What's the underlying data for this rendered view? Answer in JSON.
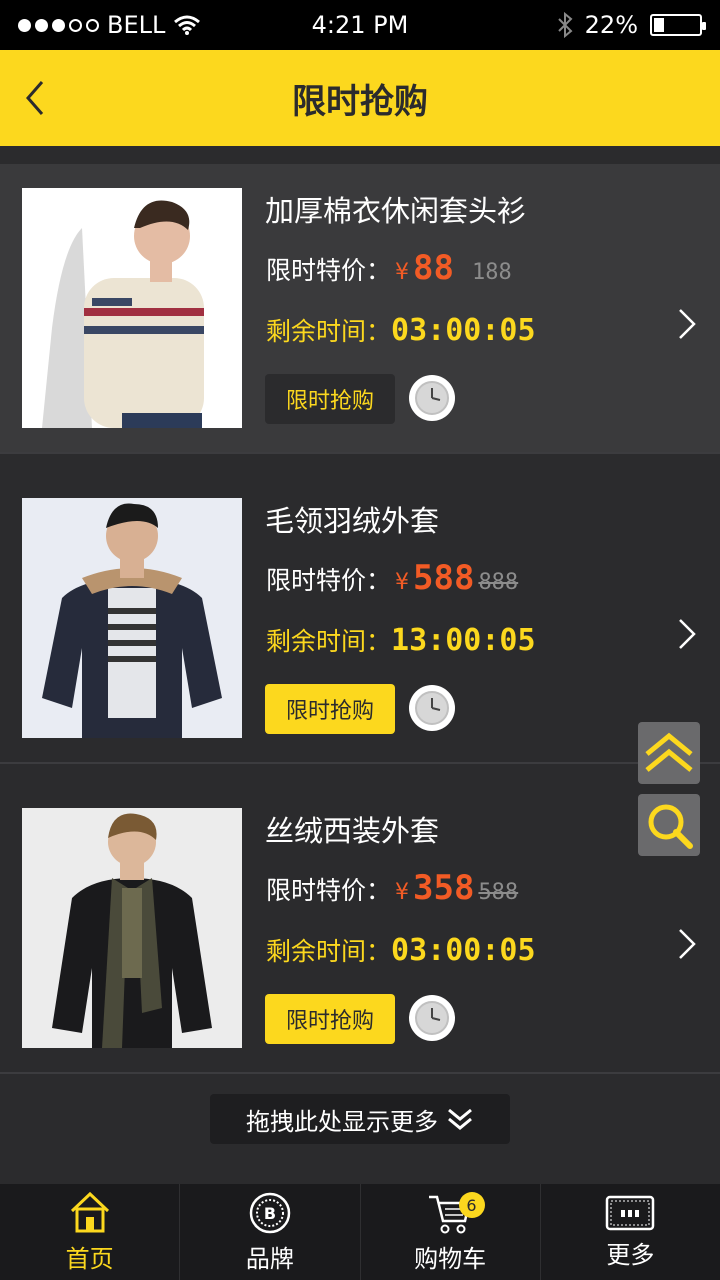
{
  "status": {
    "carrier": "BELL",
    "time": "4:21 PM",
    "battery": "22%",
    "battery_level": 0.22
  },
  "header": {
    "title": "限时抢购"
  },
  "products": [
    {
      "name": "加厚棉衣休闲套头衫",
      "price_label": "限时特价：",
      "currency": "¥",
      "price": "88",
      "old_price": "188",
      "time_label": "剩余时间：",
      "time": "03:00:05",
      "buy_label": "限时抢购"
    },
    {
      "name": "毛领羽绒外套",
      "price_label": "限时特价：",
      "currency": "¥",
      "price": "588",
      "old_price": "888",
      "time_label": "剩余时间：",
      "time": "13:00:05",
      "buy_label": "限时抢购"
    },
    {
      "name": "丝绒西装外套",
      "price_label": "限时特价：",
      "currency": "¥",
      "price": "358",
      "old_price": "588",
      "time_label": "剩余时间：",
      "time": "03:00:05",
      "buy_label": "限时抢购"
    }
  ],
  "load_more": {
    "label": "拖拽此处显示更多"
  },
  "tabbar": {
    "tabs": [
      {
        "label": "首页",
        "icon": "home-icon"
      },
      {
        "label": "品牌",
        "icon": "brand-icon"
      },
      {
        "label": "购物车",
        "icon": "cart-icon",
        "badge": "6"
      },
      {
        "label": "更多",
        "icon": "more-icon"
      }
    ]
  },
  "colors": {
    "accent": "#fcd81e",
    "price": "#f25b25",
    "background": "#2b2b2d"
  }
}
